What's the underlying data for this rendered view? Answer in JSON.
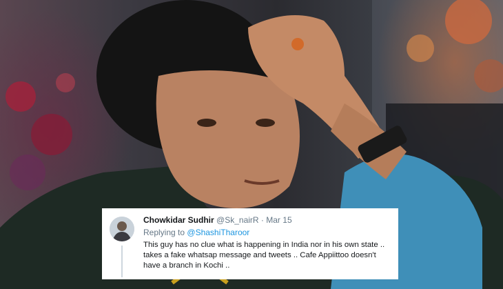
{
  "tweet": {
    "display_name": "Chowkidar Sudhir",
    "handle": "@Sk_nairR",
    "separator": "·",
    "date": "Mar 15",
    "replying_to_prefix": "Replying to",
    "replying_to_handle": "@ShashiTharoor",
    "text": "This guy has no clue what is happening in India nor in his own state .. takes a fake whatsap message and tweets .. Cafe Appiittoo doesn't have a branch in Kochi .."
  },
  "colors": {
    "mention_link": "#1b95e0",
    "secondary_text": "#657786",
    "primary_text": "#14171a",
    "card_background": "#ffffff"
  },
  "icons": {
    "avatar": "user-avatar"
  }
}
